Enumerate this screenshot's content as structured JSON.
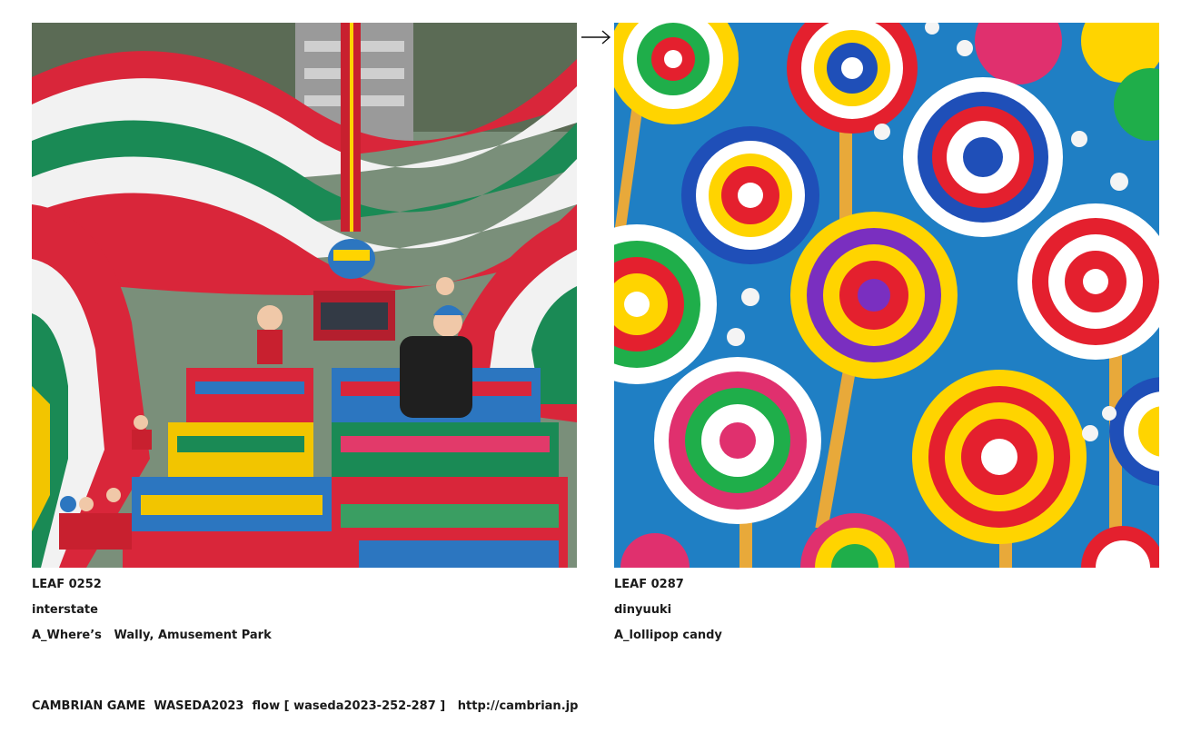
{
  "leaves": [
    {
      "id": "LEAF 0252",
      "author": "interstate",
      "prompt": "A_Where’s   Wally, Amusement Park"
    },
    {
      "id": "LEAF 0287",
      "author": "dinyuuki",
      "prompt": "A_lollipop candy"
    }
  ],
  "arrow_icon": "right-arrow-icon",
  "footer": "CAMBRIAN GAME  WASEDA2023  flow [ waseda2023-252-287 ]   http://cambrian.jp"
}
